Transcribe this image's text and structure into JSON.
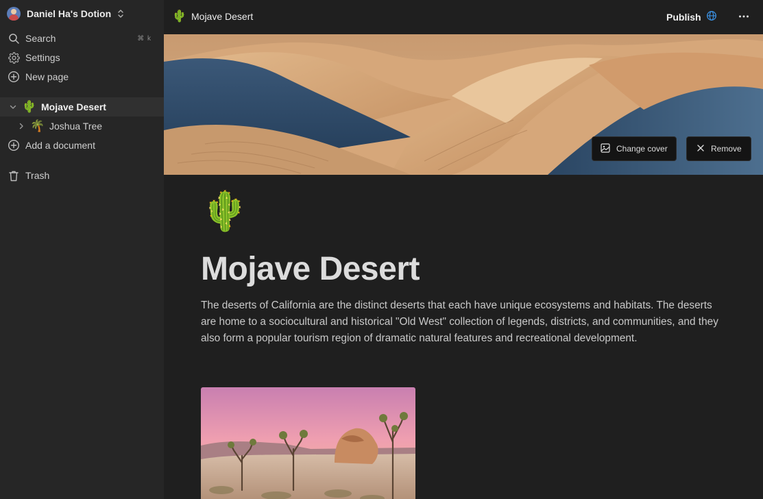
{
  "workspace": {
    "name": "Daniel Ha's Dotion"
  },
  "sidebar": {
    "search_label": "Search",
    "search_shortcut": "⌘ k",
    "settings_label": "Settings",
    "new_page_label": "New page",
    "documents": [
      {
        "label": "Mojave Desert",
        "emoji": "🌵",
        "expanded": true,
        "active": true
      },
      {
        "label": "Joshua Tree",
        "emoji": "🌴",
        "expanded": false,
        "active": false
      }
    ],
    "add_document_label": "Add a document",
    "trash_label": "Trash"
  },
  "topbar": {
    "page_emoji": "🌵",
    "page_title": "Mojave Desert",
    "publish_label": "Publish"
  },
  "cover": {
    "change_cover_label": "Change cover",
    "remove_label": "Remove"
  },
  "page": {
    "icon": "🌵",
    "title": "Mojave Desert",
    "body": "The deserts of California are the distinct deserts that each have unique ecosystems and habitats. The deserts are home to a sociocultural and historical \"Old West\" collection of legends, districts, and communities, and they also form a popular tourism region of dramatic natural features and recreational development."
  },
  "colors": {
    "accent": "#3b8fe0",
    "background": "#1f1f1f",
    "sidebar": "#262626"
  },
  "icons": [
    "chevrons-up-down-icon",
    "search-icon",
    "gear-icon",
    "plus-circle-icon",
    "chevron-down-icon",
    "chevron-right-icon",
    "trash-icon",
    "globe-icon",
    "more-horizontal-icon",
    "image-icon",
    "close-icon"
  ]
}
